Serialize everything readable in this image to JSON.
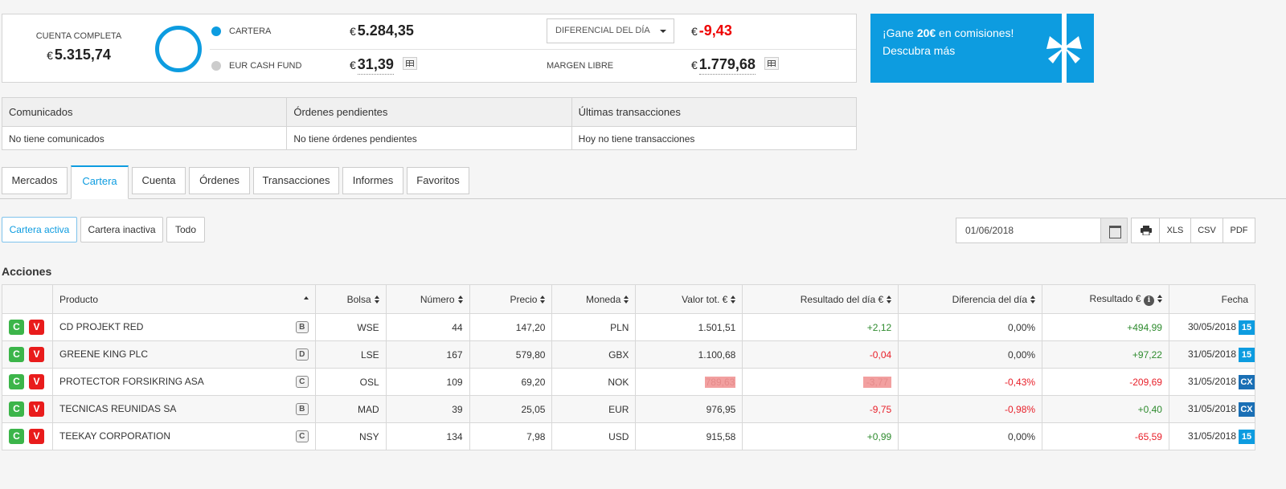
{
  "summary": {
    "full_account_label": "CUENTA COMPLETA",
    "full_account_currency": "€",
    "full_account_value": "5.315,74",
    "portfolio_label": "CARTERA",
    "portfolio_currency": "€",
    "portfolio_value": "5.284,35",
    "cash_fund_label": "EUR CASH FUND",
    "cash_fund_currency": "€",
    "cash_fund_value": "31,39",
    "day_diff_dropdown": "DIFERENCIAL DEL DÍA",
    "day_diff_currency": "€",
    "day_diff_value": "-9,43",
    "free_margin_label": "MARGEN LIBRE",
    "free_margin_currency": "€",
    "free_margin_value": "1.779,68",
    "colors": {
      "accent": "#0d9ce0",
      "negative": "#e00000",
      "cash_dot": "#cccccc"
    }
  },
  "banner": {
    "line1_prefix": "¡Gane ",
    "line1_bold": "20€",
    "line1_suffix": " en comisiones!",
    "line2": "Descubra más"
  },
  "info": [
    {
      "header": "Comunicados",
      "body": "No tiene comunicados"
    },
    {
      "header": "Órdenes pendientes",
      "body": "No tiene órdenes pendientes"
    },
    {
      "header": "Últimas transacciones",
      "body": "Hoy no tiene transacciones"
    }
  ],
  "tabs": [
    "Mercados",
    "Cartera",
    "Cuenta",
    "Órdenes",
    "Transacciones",
    "Informes",
    "Favoritos"
  ],
  "active_tab": "Cartera",
  "filters": [
    "Cartera activa",
    "Cartera inactiva",
    "Todo"
  ],
  "date_value": "01/06/2018",
  "export": [
    "XLS",
    "CSV",
    "PDF"
  ],
  "section_title": "Acciones",
  "table": {
    "headers": [
      "Producto",
      "Bolsa",
      "Número",
      "Precio",
      "Moneda",
      "Valor tot. €",
      "Resultado del día €",
      "Diferencia del día",
      "Resultado €",
      "Fecha"
    ],
    "buy_label": "C",
    "sell_label": "V",
    "rows": [
      {
        "product": "CD PROJEKT RED",
        "badge": "B",
        "exchange": "WSE",
        "number": "44",
        "price": "147,20",
        "currency": "PLN",
        "total": "1.501,51",
        "day_result": "+2,12",
        "day_diff": "0,00%",
        "result": "+494,99",
        "date": "30/05/2018",
        "day_tag": "15"
      },
      {
        "product": "GREENE KING PLC",
        "badge": "D",
        "exchange": "LSE",
        "number": "167",
        "price": "579,80",
        "currency": "GBX",
        "total": "1.100,68",
        "day_result": "-0,04",
        "day_diff": "0,00%",
        "result": "+97,22",
        "date": "31/05/2018",
        "day_tag": "15"
      },
      {
        "product": "PROTECTOR FORSIKRING ASA",
        "badge": "C",
        "exchange": "OSL",
        "number": "109",
        "price": "69,20",
        "currency": "NOK",
        "total": "789,63",
        "day_result": "-3,77",
        "day_diff": "-0,43%",
        "result": "-209,69",
        "date": "31/05/2018",
        "day_tag": "CX"
      },
      {
        "product": "TECNICAS REUNIDAS SA",
        "badge": "B",
        "exchange": "MAD",
        "number": "39",
        "price": "25,05",
        "currency": "EUR",
        "total": "976,95",
        "day_result": "-9,75",
        "day_diff": "-0,98%",
        "result": "+0,40",
        "date": "31/05/2018",
        "day_tag": "CX"
      },
      {
        "product": "TEEKAY CORPORATION",
        "badge": "C",
        "exchange": "NSY",
        "number": "134",
        "price": "7,98",
        "currency": "USD",
        "total": "915,58",
        "day_result": "+0,99",
        "day_diff": "0,00%",
        "result": "-65,59",
        "date": "31/05/2018",
        "day_tag": "15"
      }
    ]
  }
}
